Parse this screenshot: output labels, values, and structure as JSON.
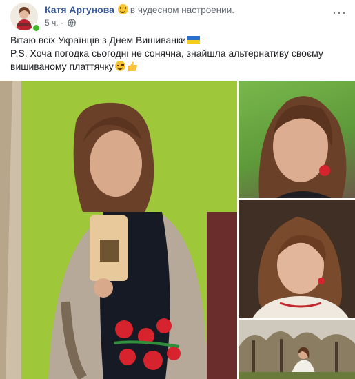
{
  "post": {
    "author": "Катя Аргунова",
    "feeling": "в чудесном настроении.",
    "time": "5 ч.",
    "more": "···",
    "text_line1": "Вітаю всіх Українців з Днем Вишиванки",
    "text_line2": "P.S. Хоча погодка сьогодні не сонячна, знайшла альтернативу своєму вишиваному платтячку",
    "icons": {
      "feeling_emoji": "smiling-face-icon",
      "privacy": "globe-icon",
      "flag": "ukraine-flag-icon",
      "wink": "winking-face-icon",
      "thumb": "thumbs-up-icon"
    },
    "colors": {
      "link": "#385898",
      "meta": "#616770",
      "online": "#42b72a",
      "flag_blue": "#2a6fd1",
      "flag_yellow": "#f3cd1c"
    }
  },
  "photos": [
    {
      "name": "Mirror selfie in embroidered dress"
    },
    {
      "name": "Portrait close-up"
    },
    {
      "name": "Portrait with curled hair"
    },
    {
      "name": "Outdoor park photo"
    }
  ]
}
